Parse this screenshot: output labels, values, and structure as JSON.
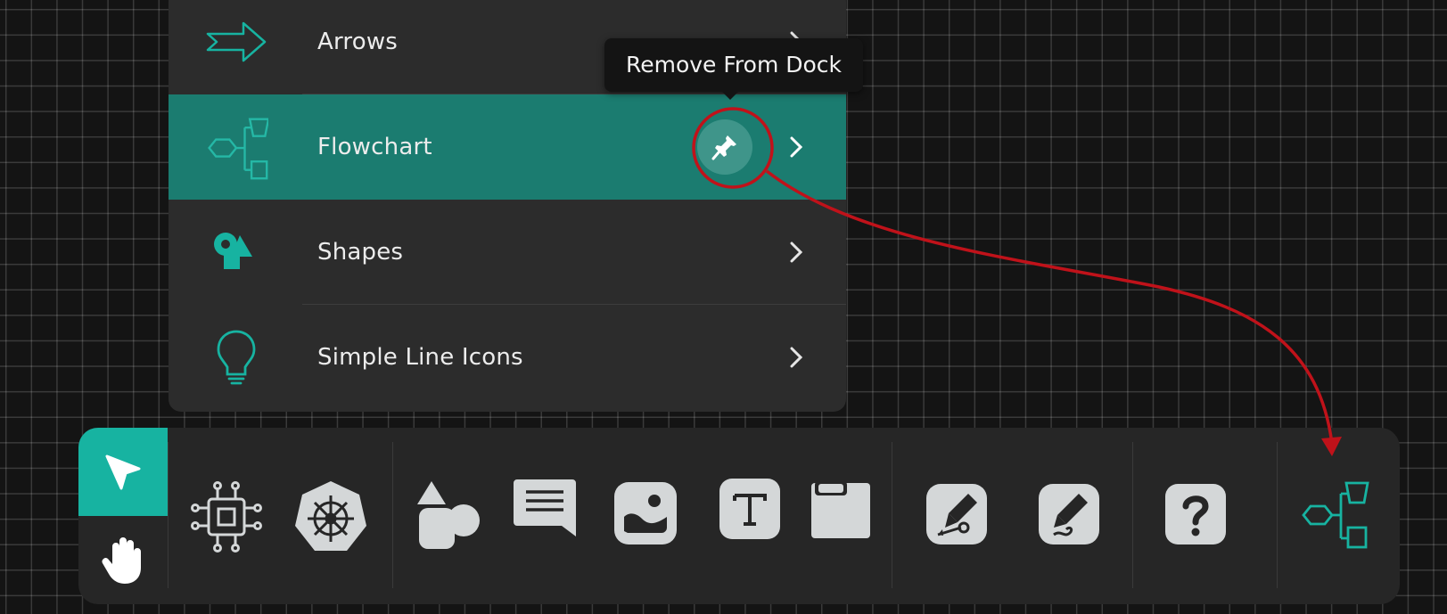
{
  "menu": {
    "items": [
      {
        "label": "Arrows",
        "icon": "arrow-right-icon"
      },
      {
        "label": "Flowchart",
        "icon": "flowchart-icon",
        "active": true
      },
      {
        "label": "Shapes",
        "icon": "shapes-icon"
      },
      {
        "label": "Simple Line Icons",
        "icon": "lightbulb-icon"
      }
    ]
  },
  "tooltip": {
    "text": "Remove From Dock"
  },
  "dock": {
    "tools": [
      {
        "name": "select-tool",
        "icon": "cursor-icon",
        "active": true
      },
      {
        "name": "pan-tool",
        "icon": "hand-icon"
      },
      {
        "name": "integrations-tool",
        "icon": "circuit-icon"
      },
      {
        "name": "kubernetes-tool",
        "icon": "kubernetes-icon"
      },
      {
        "name": "shapes-tool",
        "icon": "shapes-icon"
      },
      {
        "name": "comment-tool",
        "icon": "comment-icon"
      },
      {
        "name": "image-tool",
        "icon": "image-icon"
      },
      {
        "name": "text-tool",
        "icon": "text-icon"
      },
      {
        "name": "frame-tool",
        "icon": "frame-icon"
      },
      {
        "name": "pen-tool",
        "icon": "pen-icon"
      },
      {
        "name": "pencil-tool",
        "icon": "pencil-icon"
      },
      {
        "name": "help-tool",
        "icon": "help-icon"
      },
      {
        "name": "flowchart-dock-tool",
        "icon": "flowchart-icon"
      }
    ]
  },
  "colors": {
    "accent": "#1b7c70",
    "accent_bright": "#17b3a1",
    "annotation": "#c0121a",
    "menu_bg": "#2c2c2c",
    "dock_bg": "#262626"
  }
}
